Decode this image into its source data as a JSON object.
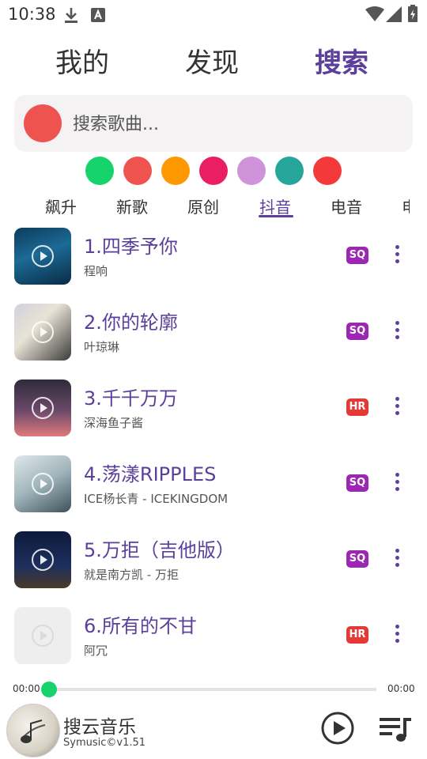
{
  "status_bar": {
    "time": "10:38",
    "icons": [
      "download-icon",
      "text-a-icon",
      "wifi-icon",
      "signal-icon",
      "battery-icon"
    ]
  },
  "top_tabs": [
    {
      "label": "我的",
      "active": false
    },
    {
      "label": "发现",
      "active": false
    },
    {
      "label": "搜索",
      "active": true
    }
  ],
  "search": {
    "placeholder": "搜索歌曲..."
  },
  "color_swatches": [
    "#16d46b",
    "#ef5350",
    "#ff9800",
    "#e91e63",
    "#ce93d8",
    "#26a69a",
    "#f4393b"
  ],
  "category_tabs": [
    {
      "label": "飙升",
      "active": false
    },
    {
      "label": "新歌",
      "active": false
    },
    {
      "label": "原创",
      "active": false
    },
    {
      "label": "抖音",
      "active": true
    },
    {
      "label": "电音",
      "active": false
    },
    {
      "label": "电",
      "active": false
    }
  ],
  "songs": [
    {
      "title": "1.四季予你",
      "artist": "程响",
      "quality": "SQ",
      "quality_color": "#9c27b0"
    },
    {
      "title": "2.你的轮廓",
      "artist": "叶琼琳",
      "quality": "SQ",
      "quality_color": "#9c27b0"
    },
    {
      "title": "3.千千万万",
      "artist": "深海鱼子酱",
      "quality": "HR",
      "quality_color": "#e53935"
    },
    {
      "title": "4.荡漾RIPPLES",
      "artist": "ICE杨长青 - ICEKINGDOM",
      "quality": "SQ",
      "quality_color": "#9c27b0"
    },
    {
      "title": "5.万拒（吉他版）",
      "artist": "就是南方凯 - 万拒",
      "quality": "SQ",
      "quality_color": "#9c27b0"
    },
    {
      "title": "6.所有的不甘",
      "artist": "阿冗",
      "quality": "HR",
      "quality_color": "#e53935"
    }
  ],
  "player": {
    "elapsed": "00:00",
    "duration": "00:00",
    "progress": 0,
    "title": "搜云音乐",
    "subtitle": "Symusic©v1.51"
  },
  "accent_color": "#5b3f9a"
}
